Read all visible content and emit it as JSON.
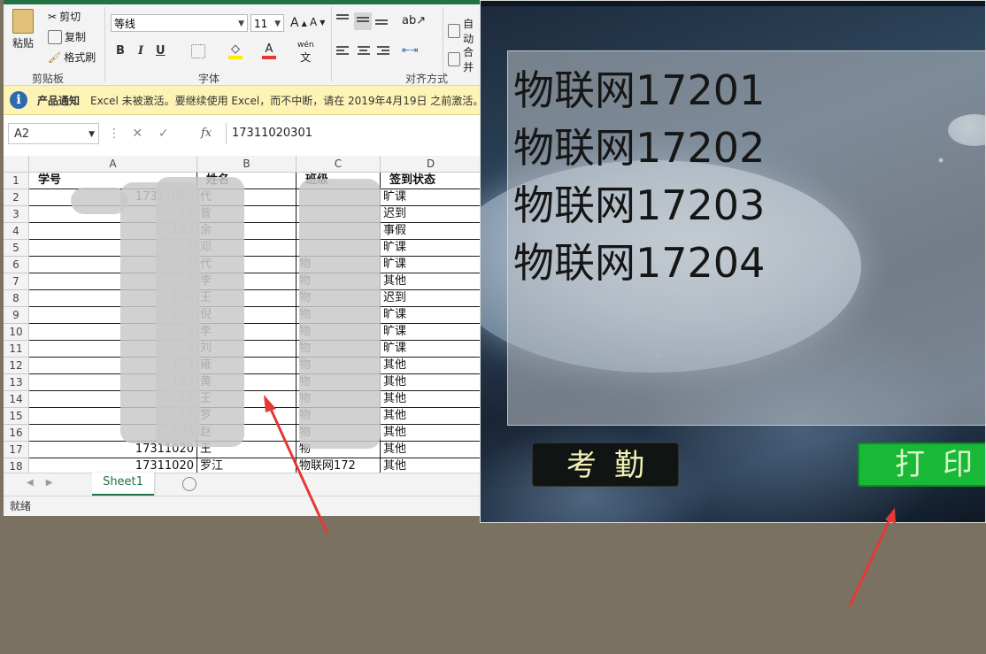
{
  "excel": {
    "ribbon": {
      "paste": "粘贴",
      "cut": "剪切",
      "copy": "复制",
      "format_painter": "格式刷",
      "clipboard_group": "剪贴板",
      "font_name": "等线",
      "font_size": "11",
      "font_group": "字体",
      "bold": "B",
      "italic": "I",
      "underline": "U",
      "phonetic": "wén",
      "align_group": "对齐方式",
      "wrap_text": "自动",
      "merge": "合并"
    },
    "notice": {
      "title": "产品通知",
      "message": "Excel 未被激活。要继续使用 Excel，而不中断，请在 2019年4月19日 之前激活。"
    },
    "name_box": "A2",
    "fx": "fx",
    "formula": "17311020301",
    "columns": [
      "A",
      "B",
      "C",
      "D"
    ],
    "header_row": [
      "学号",
      "姓名",
      "班级",
      "签到状态"
    ],
    "rows": [
      {
        "n": "2",
        "a": "17311020",
        "b": "代",
        "c": "",
        "d": "旷课"
      },
      {
        "n": "3",
        "a": "17",
        "b": "曾",
        "c": "",
        "d": "迟到"
      },
      {
        "n": "4",
        "a": "173",
        "b": "余",
        "c": "",
        "d": "事假"
      },
      {
        "n": "5",
        "a": "1",
        "b": "邓",
        "c": "",
        "d": "旷课"
      },
      {
        "n": "6",
        "a": "1",
        "b": "代",
        "c": "物",
        "d": "旷课"
      },
      {
        "n": "7",
        "a": "3",
        "b": "李",
        "c": "物",
        "d": "其他"
      },
      {
        "n": "8",
        "a": "130",
        "b": "王",
        "c": "物",
        "d": "迟到"
      },
      {
        "n": "9",
        "a": "105",
        "b": "倪",
        "c": "物",
        "d": "旷课"
      },
      {
        "n": "10",
        "a": "3",
        "b": "李",
        "c": "物",
        "d": "旷课"
      },
      {
        "n": "11",
        "a": "5",
        "b": "刘",
        "c": "物",
        "d": "旷课"
      },
      {
        "n": "12",
        "a": "173",
        "b": "雍",
        "c": "物",
        "d": "其他"
      },
      {
        "n": "13",
        "a": "173",
        "b": "黄",
        "c": "物",
        "d": "其他"
      },
      {
        "n": "14",
        "a": "17",
        "b": "王",
        "c": "物",
        "d": "其他"
      },
      {
        "n": "15",
        "a": "17",
        "b": "罗",
        "c": "物",
        "d": "其他"
      },
      {
        "n": "16",
        "a": "173",
        "b": "赵",
        "c": "物",
        "d": "其他"
      },
      {
        "n": "17",
        "a": "17311020",
        "b": "王",
        "c": "物",
        "d": "其他"
      },
      {
        "n": "18",
        "a": "17311020",
        "b": "罗江",
        "c": "物联网172",
        "d": "其他"
      }
    ],
    "row1_label": "1",
    "sheet_tab": "Sheet1",
    "status": "就绪"
  },
  "app": {
    "lines": [
      "物联网17201",
      "物联网17202",
      "物联网17203",
      "物联网17204"
    ],
    "attendance_button": "考勤",
    "print_button": "打印"
  },
  "colors": {
    "excel_green": "#217346",
    "print_green": "#19b837",
    "arrow_red": "#e53935",
    "desktop": "#7a7160"
  }
}
